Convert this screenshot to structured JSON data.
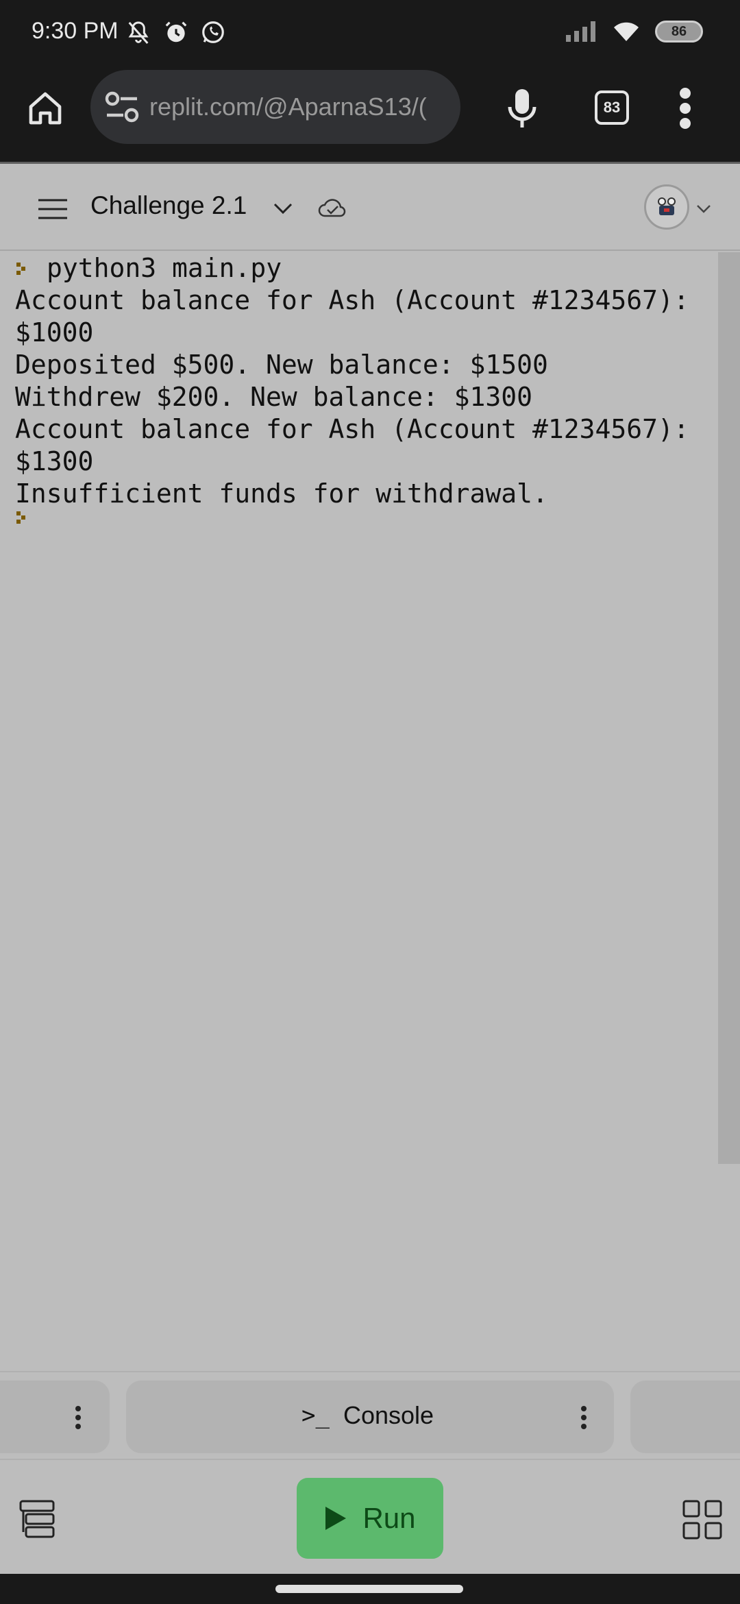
{
  "status_bar": {
    "time": "9:30 PM",
    "battery": "86",
    "icons": [
      "notifications-muted-icon",
      "alarm-icon",
      "whatsapp-icon",
      "signal-icon",
      "wifi-icon",
      "battery-icon"
    ]
  },
  "browser": {
    "url": "replit.com/@AparnaS13/(",
    "tab_count": "83",
    "icons": [
      "home-icon",
      "site-settings-icon",
      "microphone-icon",
      "tabs-icon",
      "more-menu-icon"
    ]
  },
  "header": {
    "repl_title": "Challenge 2.1",
    "icons": [
      "hamburger-menu-icon",
      "chevron-down-icon",
      "cloud-check-icon",
      "avatar-icon"
    ]
  },
  "console": {
    "command": "python3 main.py",
    "output_lines": [
      "Account balance for Ash (Account #1234567):",
      "$1000",
      "Deposited $500. New balance: $1500",
      "Withdrew $200. New balance: $1300",
      "Account balance for Ash (Account #1234567):",
      "$1300",
      "Insufficient funds for withdrawal."
    ]
  },
  "tabs": {
    "console_glyph": ">_",
    "console_label": "Console"
  },
  "toolbar": {
    "run_label": "Run",
    "icons": [
      "files-icon",
      "play-icon",
      "apps-grid-icon"
    ]
  },
  "colors": {
    "run_button": "#5cb96d",
    "run_text": "#0d4a17",
    "prompt_accent": "#7a5a00",
    "chrome_dark": "#191919",
    "dimmed_surface": "#bdbdbd"
  }
}
